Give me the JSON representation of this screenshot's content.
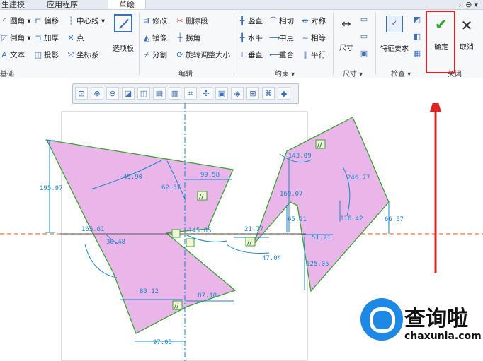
{
  "tabs": [
    {
      "label": "生建模",
      "active": false
    },
    {
      "label": "应用程序",
      "active": false
    },
    {
      "label": "草绘",
      "active": true
    }
  ],
  "ribbon": {
    "col1": [
      {
        "icon": "arc",
        "label": "圆角 ▾"
      },
      {
        "icon": "arc",
        "label": "倒角 ▾"
      },
      {
        "icon": "A",
        "label": "文本"
      }
    ],
    "col2": [
      {
        "icon": "offset",
        "label": "偏移"
      },
      {
        "icon": "thicken",
        "label": "加厚"
      },
      {
        "icon": "project",
        "label": "投影"
      }
    ],
    "col3": [
      {
        "icon": "centerline",
        "label": "中心线 ▾"
      },
      {
        "icon": "point",
        "label": "点"
      },
      {
        "icon": "csys",
        "label": "坐标系"
      }
    ],
    "palette_label": "选项板",
    "edit": [
      {
        "label": "修改"
      },
      {
        "label": "删除段"
      },
      {
        "label": "镜像"
      },
      {
        "label": "拐角"
      },
      {
        "label": "分割"
      },
      {
        "label": "旋转调整大小"
      }
    ],
    "constraints": [
      {
        "label": "竖直"
      },
      {
        "label": "相切"
      },
      {
        "label": "对称"
      },
      {
        "label": "水平"
      },
      {
        "label": "中点"
      },
      {
        "label": "相等"
      },
      {
        "label": "垂直"
      },
      {
        "label": "重合"
      },
      {
        "label": "平行"
      }
    ],
    "dimension_label": "尺寸",
    "feature_req_label": "特征要求",
    "ok_label": "确定",
    "cancel_label": "取消",
    "groups": {
      "g1": "基础",
      "edit": "编辑",
      "constraint": "约束 ▾",
      "dimension": "尺寸 ▾",
      "inspect": "检查 ▾",
      "close": "关闭"
    }
  },
  "dimensions": [
    "195.97",
    "49.90",
    "99.58",
    "62.57",
    "165.61",
    "30.48",
    "145.85",
    "21.77",
    "47.04",
    "80.12",
    "87.10",
    "97.05",
    "143.09",
    "169.07",
    "246.77",
    "116.42",
    "65.21",
    "66.57",
    "51.21",
    "125.05"
  ],
  "watermark": {
    "title": "查询啦",
    "url": "chaxunla.com"
  },
  "colors": {
    "fill": "#eab6ea",
    "edge": "#3aa335",
    "dim": "#1a86c8",
    "axis": "#f07a3a",
    "highlight": "#e02424"
  }
}
